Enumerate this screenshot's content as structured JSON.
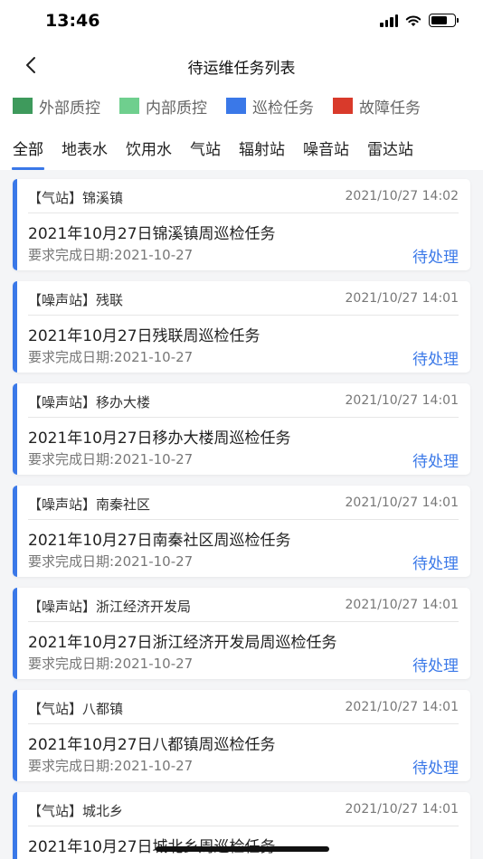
{
  "status_bar": {
    "time": "13:46",
    "battery_level": 0.7
  },
  "nav": {
    "back_icon": "chevron-left-icon",
    "title": "待运维任务列表"
  },
  "legend": [
    {
      "label": "外部质控",
      "color": "#3e9a5c"
    },
    {
      "label": "内部质控",
      "color": "#6fcf8e"
    },
    {
      "label": "巡检任务",
      "color": "#3a78e8"
    },
    {
      "label": "故障任务",
      "color": "#d93a2b"
    }
  ],
  "tabs": [
    {
      "label": "全部",
      "active": true
    },
    {
      "label": "地表水",
      "active": false
    },
    {
      "label": "饮用水",
      "active": false
    },
    {
      "label": "气站",
      "active": false
    },
    {
      "label": "辐射站",
      "active": false
    },
    {
      "label": "噪音站",
      "active": false
    },
    {
      "label": "雷达站",
      "active": false
    }
  ],
  "tasks": [
    {
      "station": "【气站】锦溪镇",
      "time": "2021/10/27 14:02",
      "title": "2021年10月27日锦溪镇周巡检任务",
      "due": "要求完成日期:2021-10-27",
      "status": "待处理",
      "type_color": "#3a78e8"
    },
    {
      "station": "【噪声站】残联",
      "time": "2021/10/27 14:01",
      "title": "2021年10月27日残联周巡检任务",
      "due": "要求完成日期:2021-10-27",
      "status": "待处理",
      "type_color": "#3a78e8"
    },
    {
      "station": "【噪声站】移办大楼",
      "time": "2021/10/27 14:01",
      "title": "2021年10月27日移办大楼周巡检任务",
      "due": "要求完成日期:2021-10-27",
      "status": "待处理",
      "type_color": "#3a78e8"
    },
    {
      "station": "【噪声站】南秦社区",
      "time": "2021/10/27 14:01",
      "title": "2021年10月27日南秦社区周巡检任务",
      "due": "要求完成日期:2021-10-27",
      "status": "待处理",
      "type_color": "#3a78e8"
    },
    {
      "station": "【噪声站】浙江经济开发局",
      "time": "2021/10/27 14:01",
      "title": "2021年10月27日浙江经济开发局周巡检任务",
      "due": "要求完成日期:2021-10-27",
      "status": "待处理",
      "type_color": "#3a78e8"
    },
    {
      "station": "【气站】八都镇",
      "time": "2021/10/27 14:01",
      "title": "2021年10月27日八都镇周巡检任务",
      "due": "要求完成日期:2021-10-27",
      "status": "待处理",
      "type_color": "#3a78e8"
    },
    {
      "station": "【气站】城北乡",
      "time": "2021/10/27 14:01",
      "title": "2021年10月27日城北乡周巡检任务",
      "due": "",
      "status": "",
      "type_color": "#3a78e8"
    }
  ]
}
